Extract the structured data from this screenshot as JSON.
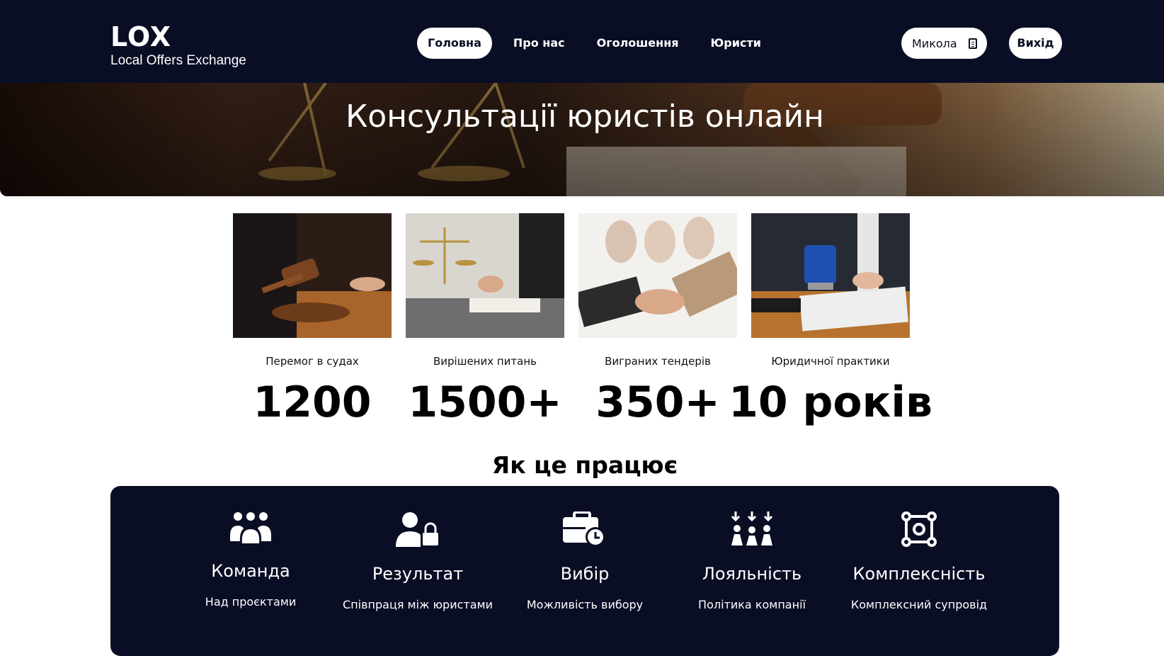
{
  "header": {
    "logo_title": "LOX",
    "logo_subtitle": "Local Offers Exchange",
    "nav": [
      {
        "label": "Головна",
        "active": true
      },
      {
        "label": "Про нас",
        "active": false
      },
      {
        "label": "Оголошення",
        "active": false
      },
      {
        "label": "Юристи",
        "active": false
      }
    ],
    "user_label": "Микола",
    "logout_label": "Вихід"
  },
  "hero": {
    "title": "Консультації юристів онлайн"
  },
  "stats": [
    {
      "label": "Перемог в судах",
      "value": "1200",
      "image": "judge-gavel-photo"
    },
    {
      "label": "Вирішених питань",
      "value": "1500+",
      "image": "scales-signing-photo"
    },
    {
      "label": "Виграних тендерів",
      "value": "350+",
      "image": "handshake-photo"
    },
    {
      "label": "Юридичної практики",
      "value": "10 років",
      "image": "stamp-document-photo"
    }
  ],
  "how_it_works": {
    "title": "Як це працює",
    "features": [
      {
        "title": "Команда",
        "text": "Над проєктами",
        "icon": "team-icon"
      },
      {
        "title": "Результат",
        "text": "Співпраця між юристами",
        "icon": "user-lock-icon"
      },
      {
        "title": "Вибір",
        "text": "Можливість вибору",
        "icon": "briefcase-clock-icon"
      },
      {
        "title": "Лояльність",
        "text": "Політика компанії",
        "icon": "people-arrows-icon"
      },
      {
        "title": "Комплексність",
        "text": "Комплексний супровід",
        "icon": "object-group-icon"
      }
    ]
  },
  "colors": {
    "navy": "#0a0e24",
    "white": "#ffffff"
  }
}
